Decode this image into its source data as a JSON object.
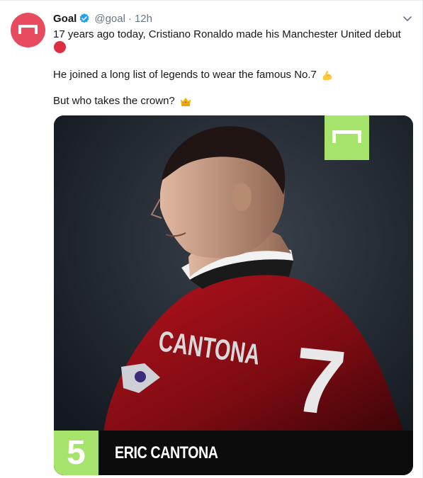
{
  "tweet": {
    "author_name": "Goal",
    "handle": "@goal",
    "separator": "·",
    "time": "12h",
    "verified_icon": "verified-badge-icon",
    "line1": "17 years ago today, Cristiano Ronaldo made his Manchester United debut",
    "line1_emoji": "red-circle-icon",
    "line3": "He joined a long list of legends to wear the famous No.7",
    "line3_emoji": "flexed-biceps-icon",
    "line4": "But who takes the crown?",
    "line4_emoji": "crown-icon"
  },
  "media": {
    "rank": "5",
    "player_name": "ERIC CANTONA",
    "shirt_name": "CANTONA",
    "shirt_number": "7",
    "accent_color": "#a5e36a",
    "brand_color": "#e84a5f"
  }
}
